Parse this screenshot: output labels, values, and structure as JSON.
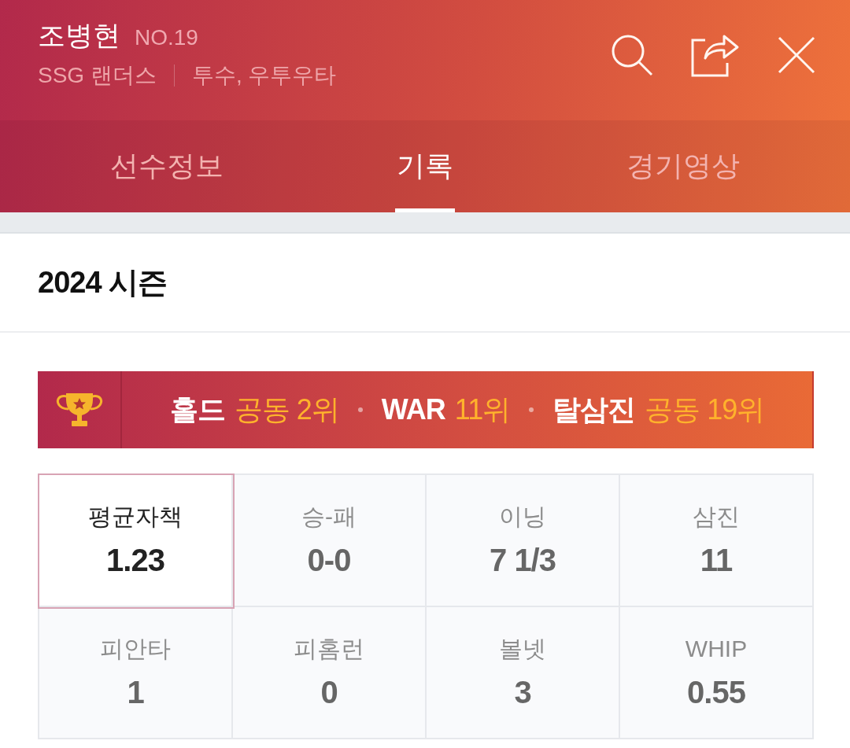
{
  "player": {
    "name": "조병현",
    "number": "NO.19",
    "team": "SSG 랜더스",
    "position": "투수, 우투우타"
  },
  "tabs": [
    {
      "label": "선수정보",
      "selected": false
    },
    {
      "label": "기록",
      "selected": true
    },
    {
      "label": "경기영상",
      "selected": false
    }
  ],
  "season": {
    "title": "2024 시즌"
  },
  "rankings": [
    {
      "category": "홀드",
      "rank": "공동 2위"
    },
    {
      "category": "WAR",
      "rank": "11위"
    },
    {
      "category": "탈삼진",
      "rank": "공동 19위"
    }
  ],
  "stats": [
    {
      "label": "평균자책",
      "value": "1.23",
      "selected": true
    },
    {
      "label": "승-패",
      "value": "0-0",
      "selected": false
    },
    {
      "label": "이닝",
      "value": "7 1/3",
      "selected": false
    },
    {
      "label": "삼진",
      "value": "11",
      "selected": false
    },
    {
      "label": "피안타",
      "value": "1",
      "selected": false
    },
    {
      "label": "피홈런",
      "value": "0",
      "selected": false
    },
    {
      "label": "볼넷",
      "value": "3",
      "selected": false
    },
    {
      "label": "WHIP",
      "value": "0.55",
      "selected": false
    }
  ]
}
